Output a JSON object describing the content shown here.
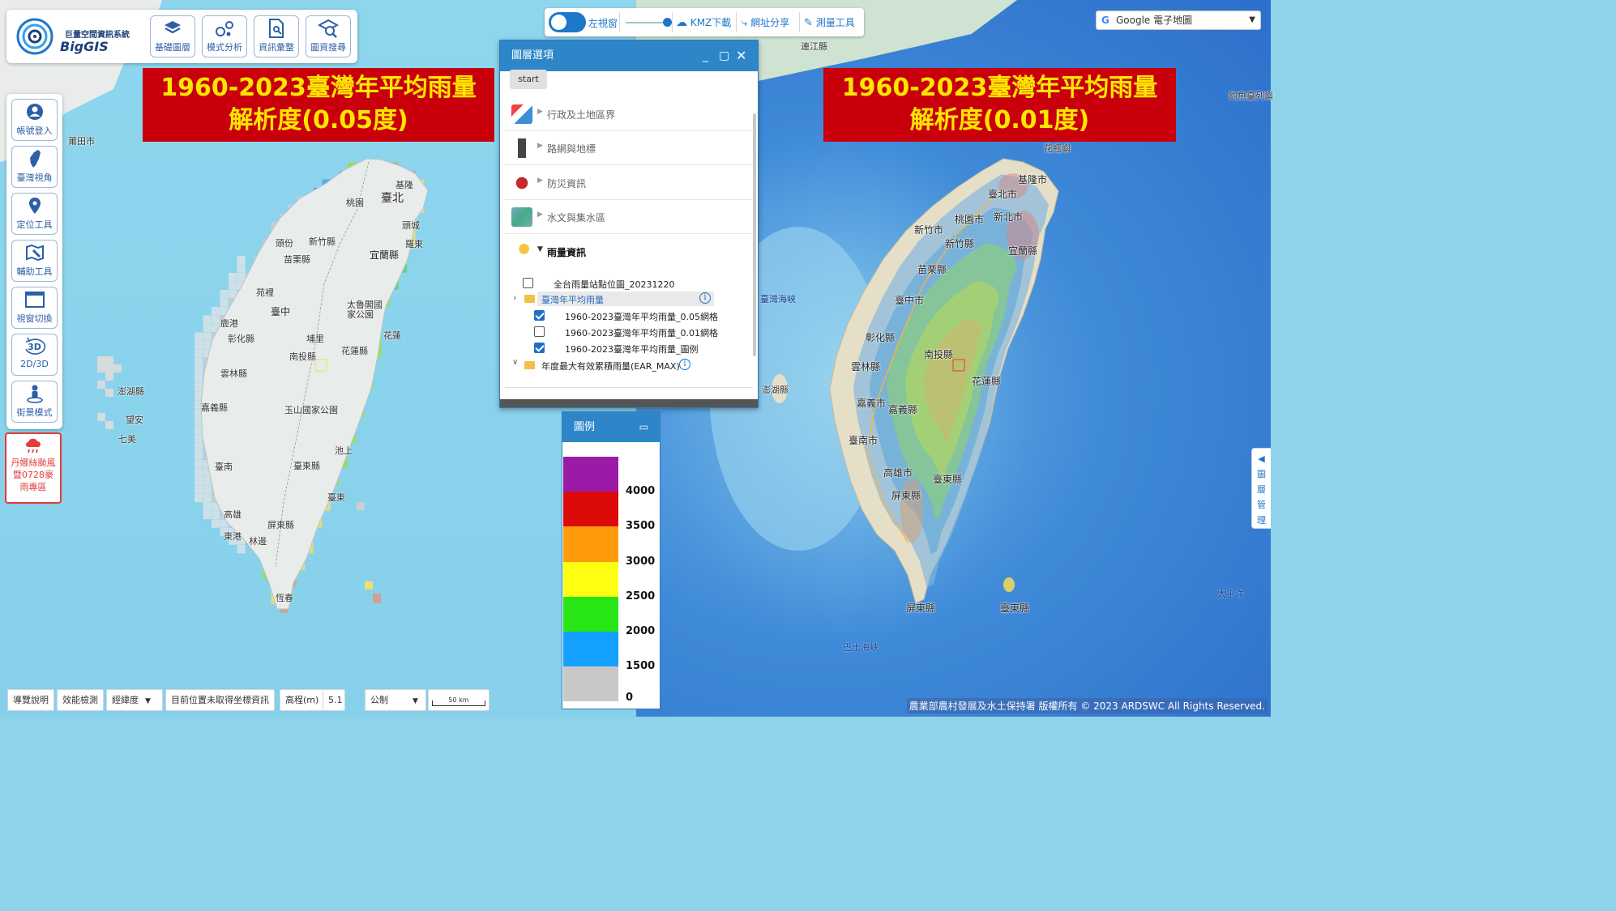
{
  "brand": {
    "title": "巨量空間資訊系統",
    "name": "BigGIS"
  },
  "top_tools": [
    {
      "label": "基礎圖層",
      "icon": "layers-icon"
    },
    {
      "label": "模式分析",
      "icon": "analysis-icon"
    },
    {
      "label": "資訊彙整",
      "icon": "document-info-icon"
    },
    {
      "label": "圖資搜尋",
      "icon": "map-search-icon"
    }
  ],
  "side_tools": [
    {
      "label": "帳號登入",
      "icon": "user-icon"
    },
    {
      "label": "臺灣視角",
      "icon": "taiwan-icon"
    },
    {
      "label": "定位工具",
      "icon": "location-pin-icon"
    },
    {
      "label": "輔助工具",
      "icon": "map-tool-icon"
    },
    {
      "label": "視窗切換",
      "icon": "window-icon"
    },
    {
      "label": "2D/3D",
      "icon": "3d-rotate-icon",
      "badge": "3D"
    },
    {
      "label": "街景模式",
      "icon": "streetview-icon"
    }
  ],
  "typhoon_button": {
    "label": "丹娜絲颱風暨0728豪雨專區"
  },
  "titles": {
    "left": {
      "line1": "1960-2023臺灣年平均雨量",
      "line2": "解析度(0.05度)"
    },
    "right": {
      "line1": "1960-2023臺灣年平均雨量",
      "line2": "解析度(0.01度)"
    }
  },
  "top_center": {
    "left_window": "左視窗",
    "kmz": "KMZ下載",
    "share": "網址分享",
    "measure": "測量工具",
    "toggle_on": true
  },
  "basemap": {
    "selected": "Google 電子地圖"
  },
  "layer_panel": {
    "title": "圖層選項",
    "start": "start",
    "categories": [
      {
        "label": "行政及土地區界",
        "open": false
      },
      {
        "label": "路網與地標",
        "open": false
      },
      {
        "label": "防災資訊",
        "open": false
      },
      {
        "label": "水文與集水區",
        "open": false
      },
      {
        "label": "雨量資訊",
        "open": true
      }
    ],
    "tree": {
      "station_layer": {
        "label": "全台雨量站點位圖_20231220",
        "checked": false
      },
      "annual_folder": {
        "label": "臺灣年平均雨量"
      },
      "children": [
        {
          "label": "1960-2023臺灣年平均雨量_0.05網格",
          "checked": true
        },
        {
          "label": "1960-2023臺灣年平均雨量_0.01網格",
          "checked": false
        },
        {
          "label": "1960-2023臺灣年平均雨量_圖例",
          "checked": true
        }
      ],
      "ear_folder": {
        "label": "年度最大有效累積雨量(EAR_MAX)"
      }
    }
  },
  "legend": {
    "title": "圖例",
    "colors": [
      "#9b1ba6",
      "#dd0a0a",
      "#ff9b0a",
      "#ffff14",
      "#28e614",
      "#14a0ff",
      "#c8c8c8"
    ],
    "labels": [
      "4000",
      "3500",
      "3000",
      "2500",
      "2000",
      "1500",
      "0"
    ]
  },
  "bottom_bar": {
    "guide": "導覽說明",
    "performance": "效能檢測",
    "coord_type": "經緯度",
    "coord_status": "目前位置未取得坐標資訊",
    "elevation_label": "高程(m)",
    "elevation_value": "5.1",
    "unit": "公制",
    "scale": "50 km"
  },
  "copyright": {
    "org": "農業部農村發展及水土保持署",
    "text": "版權所有 © 2023 ARDSWC All Rights Reserved."
  },
  "layer_manage": {
    "label": "圖層管理"
  },
  "places_left": {
    "putian": "莆田市",
    "taipei": "臺北",
    "keelung": "基隆",
    "taoyuan": "桃園",
    "yilan": "宜蘭縣",
    "hsinchu": "新竹縣",
    "toufen": "頭份",
    "miaoli": "苗栗縣",
    "yuanli": "苑裡",
    "taichung": "臺中",
    "lukang": "鹿港",
    "changhua": "彰化縣",
    "yunlin": "雲林縣",
    "chiayi": "嘉義縣",
    "tainan": "臺南",
    "kaohsiung": "高雄",
    "pingtung": "屏東縣",
    "donggang": "東港",
    "linbian": "林邊",
    "hengchun": "恆春",
    "penghu": "澎湖縣",
    "wangan": "望安",
    "qimei": "七美",
    "hualien": "花蓮縣",
    "taidong": "臺東縣",
    "taitung_city": "臺東",
    "nantou": "南投縣",
    "puli": "埔里",
    "taroko": "太魯閣國家公園",
    "yushan": "玉山國家公園",
    "chishang": "池上",
    "hualien_city": "花蓮",
    "luodong": "羅東",
    "toucheng": "頭城",
    "taoyuanair": "桃園"
  },
  "places_right": {
    "lianjiang": "連江縣",
    "keelung": "基隆市",
    "taipei": "臺北市",
    "newtaipei": "新北市",
    "taoyuan": "桃園市",
    "hsinchu_city": "新竹市",
    "hsinchu": "新竹縣",
    "yilan": "宜蘭縣",
    "miaoli": "苗栗縣",
    "taichung": "臺中市",
    "changhua": "彰化縣",
    "nantou": "南投縣",
    "hualien": "花蓮縣",
    "yunlin": "雲林縣",
    "chiayi_city": "嘉義市",
    "chiayi": "嘉義縣",
    "tainan": "臺南市",
    "kaohsiung": "高雄市",
    "pingtung": "屏東縣",
    "taitung": "臺東縣",
    "penghu": "澎湖縣",
    "strait": "臺灣海峽",
    "bashi": "巴士海峽",
    "pacific": "太平洋",
    "pingtung_s": "屏東縣",
    "taitung_s": "臺東縣",
    "diaoyu": "釣魚臺列嶼",
    "huaping": "花瓶嶼"
  }
}
